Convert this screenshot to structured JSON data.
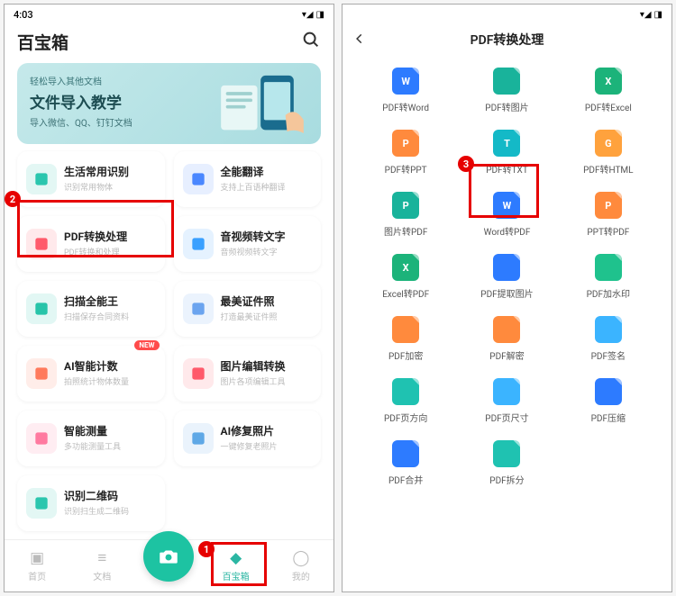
{
  "statusbar": {
    "time": "4:03",
    "net": "▾◢",
    "batt": "◨"
  },
  "left": {
    "title": "百宝箱",
    "banner": {
      "line1": "轻松导入其他文档",
      "title": "文件导入教学",
      "line3": "导入微信、QQ、钉钉文档"
    },
    "features": [
      {
        "title": "生活常用识别",
        "sub": "识别常用物体",
        "color": "#2bc6ae"
      },
      {
        "title": "全能翻译",
        "sub": "支持上百语种翻译",
        "color": "#4a87ff"
      },
      {
        "title": "PDF转换处理",
        "sub": "PDF转换和处理",
        "color": "#ff5a6b"
      },
      {
        "title": "音视频转文字",
        "sub": "音频视频转文字",
        "color": "#3aa0ff"
      },
      {
        "title": "扫描全能王",
        "sub": "扫描保存合同资料",
        "color": "#27c4a9"
      },
      {
        "title": "最美证件照",
        "sub": "打造最美证件照",
        "color": "#6ba4ef"
      },
      {
        "title": "AI智能计数",
        "sub": "拍照统计物体数量",
        "color": "#ff7a5c",
        "new": "NEW"
      },
      {
        "title": "图片编辑转换",
        "sub": "图片各项编辑工具",
        "color": "#ff5a6b"
      },
      {
        "title": "智能测量",
        "sub": "多功能测量工具",
        "color": "#ff7aa0"
      },
      {
        "title": "AI修复照片",
        "sub": "一键修复老照片",
        "color": "#5fa8e6"
      },
      {
        "title": "识别二维码",
        "sub": "识别扫生成二维码",
        "color": "#2bc6ae"
      }
    ],
    "nav": {
      "home": "首页",
      "docs": "文档",
      "box": "百宝箱",
      "mine": "我的"
    },
    "callouts": {
      "c1": "1",
      "c2": "2",
      "c3": "3"
    }
  },
  "right": {
    "title": "PDF转换处理",
    "tools": [
      {
        "label": "PDF转Word",
        "color": "#2d7bff",
        "letter": "W"
      },
      {
        "label": "PDF转图片",
        "color": "#19b39b",
        "letter": ""
      },
      {
        "label": "PDF转Excel",
        "color": "#1cb37a",
        "letter": "X"
      },
      {
        "label": "PDF转PPT",
        "color": "#ff8a3d",
        "letter": "P"
      },
      {
        "label": "PDF转TXT",
        "color": "#14b9c7",
        "letter": "T"
      },
      {
        "label": "PDF转HTML",
        "color": "#ffa23d",
        "letter": "G"
      },
      {
        "label": "图片转PDF",
        "color": "#19b39b",
        "letter": "P"
      },
      {
        "label": "Word转PDF",
        "color": "#2d7bff",
        "letter": "W"
      },
      {
        "label": "PPT转PDF",
        "color": "#ff8a3d",
        "letter": "P"
      },
      {
        "label": "Excel转PDF",
        "color": "#1cb37a",
        "letter": "X"
      },
      {
        "label": "PDF提取图片",
        "color": "#2d7bff",
        "letter": ""
      },
      {
        "label": "PDF加水印",
        "color": "#1fc28d",
        "letter": ""
      },
      {
        "label": "PDF加密",
        "color": "#ff8a3d",
        "letter": ""
      },
      {
        "label": "PDF解密",
        "color": "#ff8a3d",
        "letter": ""
      },
      {
        "label": "PDF签名",
        "color": "#3bb4ff",
        "letter": ""
      },
      {
        "label": "PDF页方向",
        "color": "#1fc2b1",
        "letter": ""
      },
      {
        "label": "PDF页尺寸",
        "color": "#3bb4ff",
        "letter": ""
      },
      {
        "label": "PDF压缩",
        "color": "#2d7bff",
        "letter": ""
      },
      {
        "label": "PDF合并",
        "color": "#2d7bff",
        "letter": ""
      },
      {
        "label": "PDF拆分",
        "color": "#1fc2b1",
        "letter": ""
      }
    ]
  }
}
